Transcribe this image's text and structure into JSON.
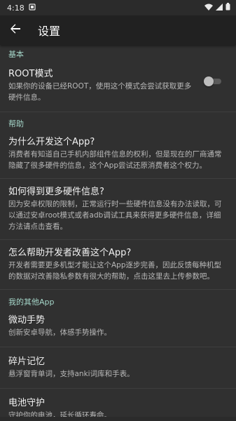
{
  "status": {
    "time": "4:18"
  },
  "app_bar": {
    "title": "设置"
  },
  "sections": {
    "basic": {
      "header": "基本",
      "root_mode": {
        "title": "ROOT模式",
        "summary": "如果你的设备已经ROOT，使用这个模式会尝试获取更多硬件信息。",
        "enabled": false
      }
    },
    "help": {
      "header": "帮助",
      "items": [
        {
          "title": "为什么开发这个App?",
          "summary": "消费者有知道自己手机内部组件信息的权利，但是现在的厂商通常隐藏了很多硬件的信息，这个App尝试还原消费者这个权力。"
        },
        {
          "title": "如何得到更多硬件信息?",
          "summary": "因为安卓权限的限制，正常运行时一些硬件信息没有办法读取，可以通过安卓root模式或者adb调试工具来获得更多硬件信息，详细方法请点击查看。"
        },
        {
          "title": "怎么帮助开发者改善这个App?",
          "summary": "开发者需要更多机型才能让这个App逐步完善，因此反馈每种机型的数据对改善隐私参数有很大的帮助，点击这里去上传参数吧。"
        }
      ]
    },
    "other_apps": {
      "header": "我的其他App",
      "items": [
        {
          "title": "微动手势",
          "summary": "创新安卓导航，体感手势操作。"
        },
        {
          "title": "碎片记忆",
          "summary": "悬浮窗背单词，支持anki词库和手表。"
        },
        {
          "title": "电池守护",
          "summary": "守护你的电池，延长循环寿命。"
        }
      ]
    }
  },
  "colors": {
    "accent": "#a5d6c9",
    "background": "#303030",
    "app_bar": "#212121"
  }
}
